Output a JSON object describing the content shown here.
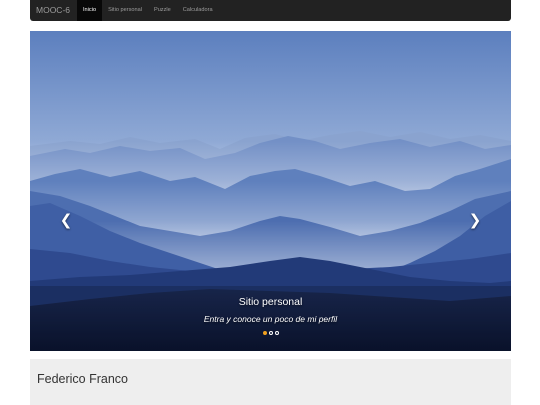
{
  "navbar": {
    "brand": "MOOC-6",
    "items": [
      {
        "label": "Inicio",
        "active": true
      },
      {
        "label": "Sitio personal",
        "active": false
      },
      {
        "label": "Puzzle",
        "active": false
      },
      {
        "label": "Calculadora",
        "active": false
      }
    ]
  },
  "carousel": {
    "caption_title": "Sitio personal",
    "caption_text": "Entra y conoce un poco de mi perfil",
    "prev_icon": "chevron-left-icon",
    "next_icon": "chevron-right-icon",
    "slide_count": 3,
    "active_slide": 1,
    "active_indicator_color": "#f0a020"
  },
  "jumbotron": {
    "heading": "Federico Franco"
  },
  "colors": {
    "navbar_bg": "#222222",
    "nav_active_bg": "#080808",
    "jumbotron_bg": "#eeeeee"
  }
}
